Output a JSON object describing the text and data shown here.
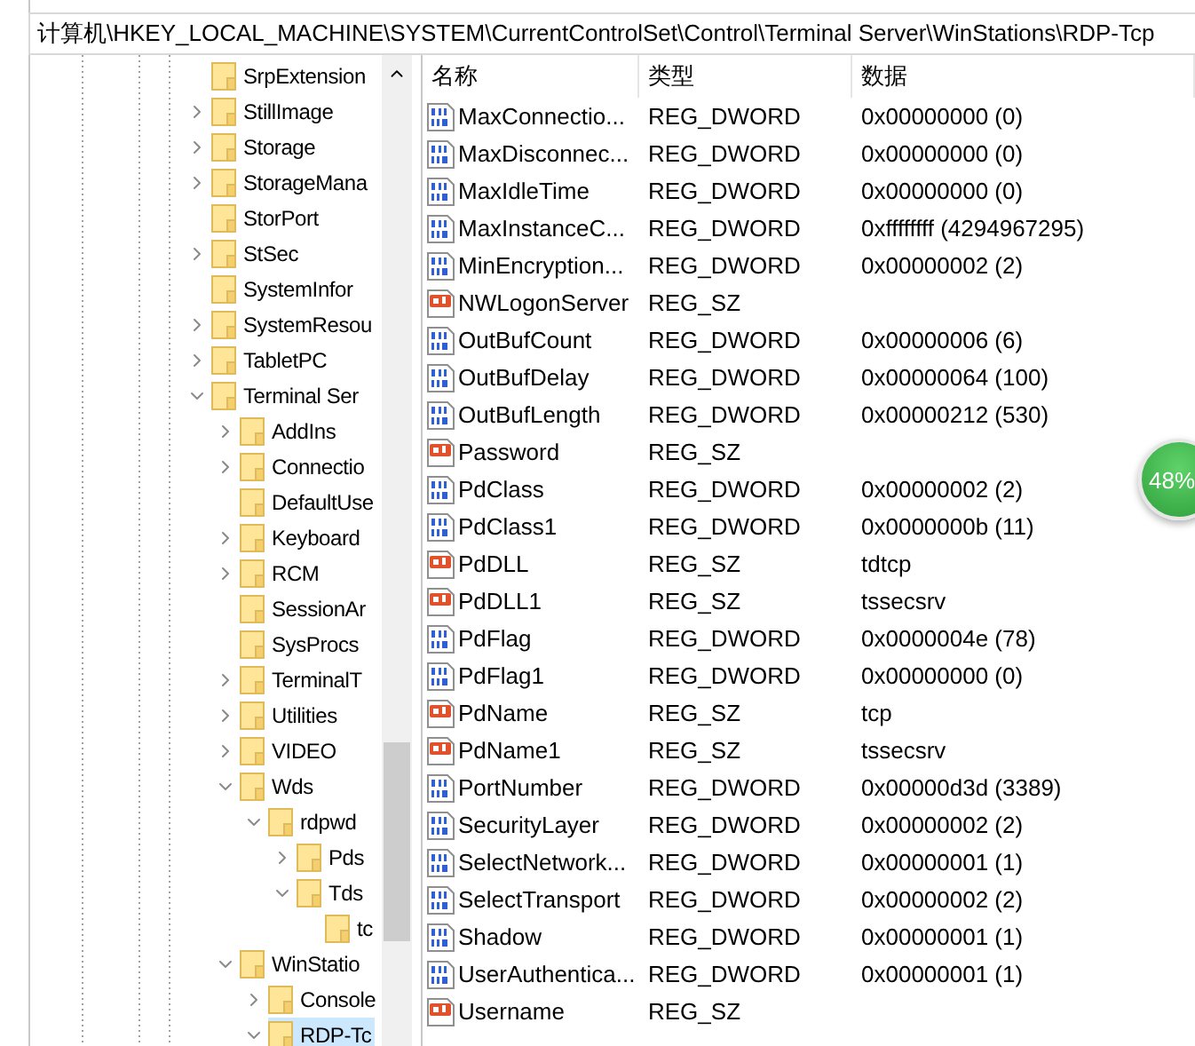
{
  "address": "计算机\\HKEY_LOCAL_MACHINE\\SYSTEM\\CurrentControlSet\\Control\\Terminal Server\\WinStations\\RDP-Tcp",
  "tree": [
    {
      "label": "SrpExtension",
      "selected": false
    },
    {
      "label": "StillImage",
      "expanded": false,
      "selected": false
    },
    {
      "label": "Storage",
      "expanded": false,
      "selected": false
    },
    {
      "label": "StorageMana",
      "expanded": false,
      "selected": false
    },
    {
      "label": "StorPort",
      "selected": false
    },
    {
      "label": "StSec",
      "expanded": false,
      "selected": false
    },
    {
      "label": "SystemInfor",
      "selected": false
    },
    {
      "label": "SystemResou",
      "expanded": false,
      "selected": false
    },
    {
      "label": "TabletPC",
      "expanded": false,
      "selected": false
    },
    {
      "label": "Terminal Ser",
      "expanded": true,
      "selected": false,
      "children": [
        {
          "label": "AddIns",
          "expanded": false,
          "selected": false
        },
        {
          "label": "Connectio",
          "expanded": false,
          "selected": false
        },
        {
          "label": "DefaultUse",
          "selected": false
        },
        {
          "label": "Keyboard",
          "expanded": false,
          "selected": false
        },
        {
          "label": "RCM",
          "expanded": false,
          "selected": false
        },
        {
          "label": "SessionAr",
          "selected": false
        },
        {
          "label": "SysProcs",
          "selected": false
        },
        {
          "label": "TerminalT",
          "expanded": false,
          "selected": false
        },
        {
          "label": "Utilities",
          "expanded": false,
          "selected": false
        },
        {
          "label": "VIDEO",
          "expanded": false,
          "selected": false
        },
        {
          "label": "Wds",
          "expanded": true,
          "selected": false,
          "children": [
            {
              "label": "rdpwd",
              "expanded": true,
              "selected": false,
              "children": [
                {
                  "label": "Pds",
                  "expanded": false,
                  "selected": false
                },
                {
                  "label": "Tds",
                  "expanded": true,
                  "selected": false,
                  "children": [
                    {
                      "label": "tc",
                      "selected": false
                    }
                  ]
                }
              ]
            }
          ]
        },
        {
          "label": "WinStatio",
          "expanded": true,
          "selected": false,
          "children": [
            {
              "label": "Console",
              "expanded": false,
              "selected": false
            },
            {
              "label": "RDP-Tc",
              "expanded": true,
              "selected": true
            }
          ]
        }
      ]
    }
  ],
  "list": {
    "columns": [
      "名称",
      "类型",
      "数据"
    ],
    "rows": [
      {
        "kind": "dword",
        "name": "MaxConnectio...",
        "type": "REG_DWORD",
        "data": "0x00000000 (0)"
      },
      {
        "kind": "dword",
        "name": "MaxDisconnec...",
        "type": "REG_DWORD",
        "data": "0x00000000 (0)"
      },
      {
        "kind": "dword",
        "name": "MaxIdleTime",
        "type": "REG_DWORD",
        "data": "0x00000000 (0)"
      },
      {
        "kind": "dword",
        "name": "MaxInstanceC...",
        "type": "REG_DWORD",
        "data": "0xffffffff (4294967295)"
      },
      {
        "kind": "dword",
        "name": "MinEncryption...",
        "type": "REG_DWORD",
        "data": "0x00000002 (2)"
      },
      {
        "kind": "string",
        "name": "NWLogonServer",
        "type": "REG_SZ"
      },
      {
        "kind": "dword",
        "name": "OutBufCount",
        "type": "REG_DWORD",
        "data": "0x00000006 (6)"
      },
      {
        "kind": "dword",
        "name": "OutBufDelay",
        "type": "REG_DWORD",
        "data": "0x00000064 (100)"
      },
      {
        "kind": "dword",
        "name": "OutBufLength",
        "type": "REG_DWORD",
        "data": "0x00000212 (530)"
      },
      {
        "kind": "string",
        "name": "Password",
        "type": "REG_SZ"
      },
      {
        "kind": "dword",
        "name": "PdClass",
        "type": "REG_DWORD",
        "data": "0x00000002 (2)"
      },
      {
        "kind": "dword",
        "name": "PdClass1",
        "type": "REG_DWORD",
        "data": "0x0000000b (11)"
      },
      {
        "kind": "string",
        "name": "PdDLL",
        "type": "REG_SZ",
        "data": "tdtcp"
      },
      {
        "kind": "string",
        "name": "PdDLL1",
        "type": "REG_SZ",
        "data": "tssecsrv"
      },
      {
        "kind": "dword",
        "name": "PdFlag",
        "type": "REG_DWORD",
        "data": "0x0000004e (78)"
      },
      {
        "kind": "dword",
        "name": "PdFlag1",
        "type": "REG_DWORD",
        "data": "0x00000000 (0)"
      },
      {
        "kind": "string",
        "name": "PdName",
        "type": "REG_SZ",
        "data": "tcp"
      },
      {
        "kind": "string",
        "name": "PdName1",
        "type": "REG_SZ",
        "data": "tssecsrv"
      },
      {
        "kind": "dword",
        "name": "PortNumber",
        "type": "REG_DWORD",
        "data": "0x00000d3d (3389)"
      },
      {
        "kind": "dword",
        "name": "SecurityLayer",
        "type": "REG_DWORD",
        "data": "0x00000002 (2)"
      },
      {
        "kind": "dword",
        "name": "SelectNetwork...",
        "type": "REG_DWORD",
        "data": "0x00000001 (1)"
      },
      {
        "kind": "dword",
        "name": "SelectTransport",
        "type": "REG_DWORD",
        "data": "0x00000002 (2)"
      },
      {
        "kind": "dword",
        "name": "Shadow",
        "type": "REG_DWORD",
        "data": "0x00000001 (1)"
      },
      {
        "kind": "dword",
        "name": "UserAuthentica...",
        "type": "REG_DWORD",
        "data": "0x00000001 (1)"
      },
      {
        "kind": "string",
        "name": "Username",
        "type": "REG_SZ"
      }
    ]
  },
  "badge": {
    "text": "48%"
  }
}
